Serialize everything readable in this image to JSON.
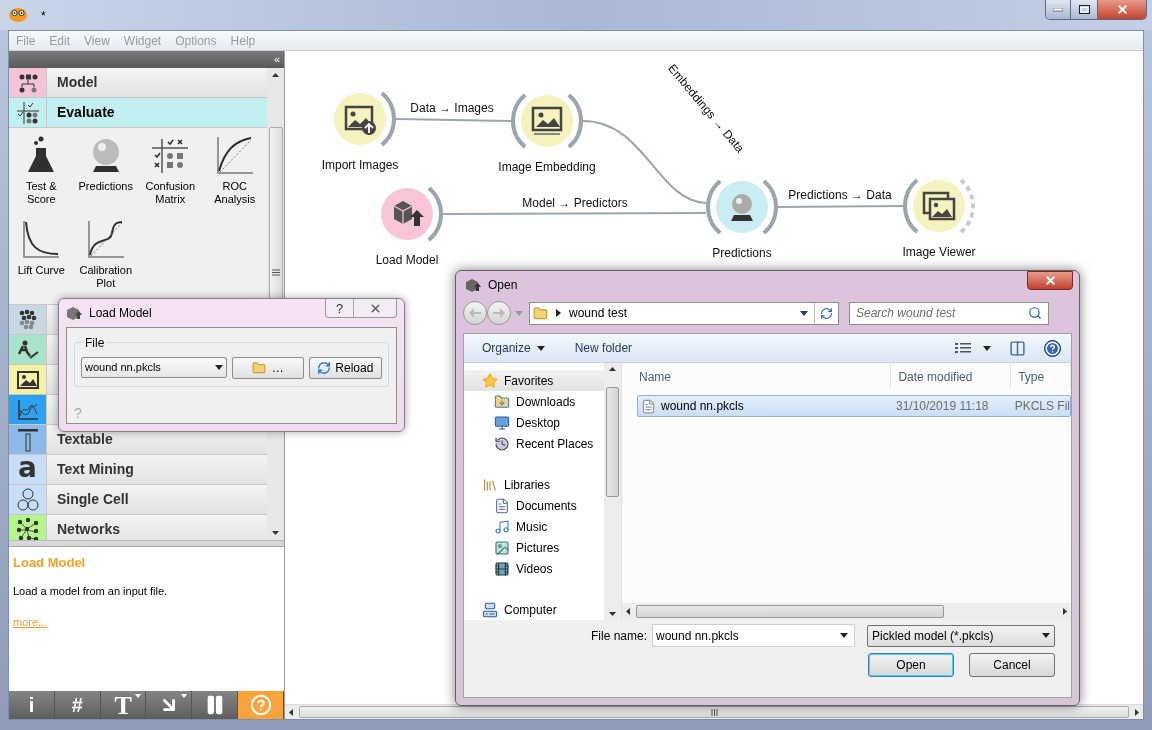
{
  "window": {
    "title": "*"
  },
  "menu": [
    "File",
    "Edit",
    "View",
    "Widget",
    "Options",
    "Help"
  ],
  "toolbox": {
    "collapse_glyph": "«",
    "categories": [
      {
        "name": "Model",
        "color": "#f4c3d8",
        "expanded": false
      },
      {
        "name": "Evaluate",
        "color": "#c2f0f0",
        "expanded": true,
        "widgets": [
          "Test & Score",
          "Predictions",
          "Confusion Matrix",
          "ROC Analysis",
          "Lift Curve",
          "Calibration Plot"
        ]
      },
      {
        "color": "#c6d9e2",
        "expanded": false
      },
      {
        "color": "#a9e3c9",
        "expanded": false
      },
      {
        "color": "#f7f1a6",
        "expanded": false
      },
      {
        "color": "#2ba3f2",
        "expanded": false
      },
      {
        "name": "Textable",
        "color": "#8cb9e8",
        "expanded": false
      },
      {
        "name": "Text Mining",
        "color": "#c8ddf7",
        "expanded": false,
        "icon_glyph": "a"
      },
      {
        "name": "Single Cell",
        "color": "#c8ddf7",
        "expanded": false
      },
      {
        "name": "Networks",
        "color": "#b5f58c",
        "expanded": false
      }
    ]
  },
  "description": {
    "title": "Load Model",
    "text": "Load a model from an input file.",
    "link": "more..."
  },
  "toolbar": [
    {
      "glyph": "i",
      "has_menu": false,
      "selected": false
    },
    {
      "glyph": "#",
      "has_menu": false,
      "selected": false
    },
    {
      "glyph": "T",
      "has_menu": true,
      "selected": false
    },
    {
      "kind": "arrow",
      "has_menu": true,
      "selected": false
    },
    {
      "kind": "pause",
      "has_menu": false,
      "selected": false
    },
    {
      "kind": "help",
      "has_menu": false,
      "selected": true
    }
  ],
  "canvas": {
    "nodes": [
      {
        "label": "Import Images",
        "color": "#f6f2bd"
      },
      {
        "label": "Image Embedding",
        "color": "#f6f2bd"
      },
      {
        "label": "Load Model",
        "color": "#f8c6d8"
      },
      {
        "label": "Predictions",
        "color": "#c9edf3"
      },
      {
        "label": "Image Viewer",
        "color": "#f6f2bd"
      }
    ],
    "links": [
      {
        "label": "Data → Images"
      },
      {
        "label": "Embeddings → Data"
      },
      {
        "label": "Model → Predictors"
      },
      {
        "label": "Predictions → Data"
      }
    ]
  },
  "load_model_dialog": {
    "title": "Load Model",
    "help_button": "?",
    "group": "File",
    "file": "wound nn.pkcls",
    "browse": "…",
    "reload": "Reload",
    "help_glyph": "?"
  },
  "open_dialog": {
    "title": "Open",
    "path": "wound test",
    "search": {
      "placeholder": "Search wound test"
    },
    "organize": "Organize",
    "new_folder": "New folder",
    "nav": [
      {
        "label": "Favorites",
        "selected": true,
        "children": [
          {
            "label": "Downloads",
            "selected": false
          },
          {
            "label": "Desktop",
            "selected": false
          },
          {
            "label": "Recent Places",
            "selected": false
          }
        ]
      },
      {
        "label": "Libraries",
        "selected": false,
        "children": [
          {
            "label": "Documents",
            "selected": false
          },
          {
            "label": "Music",
            "selected": false
          },
          {
            "label": "Pictures",
            "selected": false
          },
          {
            "label": "Videos",
            "selected": false
          }
        ]
      },
      {
        "label": "Computer",
        "selected": false
      }
    ],
    "columns": [
      "Name",
      "Date modified",
      "Type"
    ],
    "files": [
      {
        "name": "wound nn.pkcls",
        "date": "31/10/2019 11:18",
        "type": "PKCLS Fil",
        "selected": true
      }
    ],
    "file_name": {
      "label": "File name:",
      "value": "wound nn.pkcls"
    },
    "filter": "Pickled model (*.pkcls)",
    "buttons": [
      {
        "label": "Open",
        "default": true
      },
      {
        "label": "Cancel",
        "default": false
      }
    ]
  }
}
